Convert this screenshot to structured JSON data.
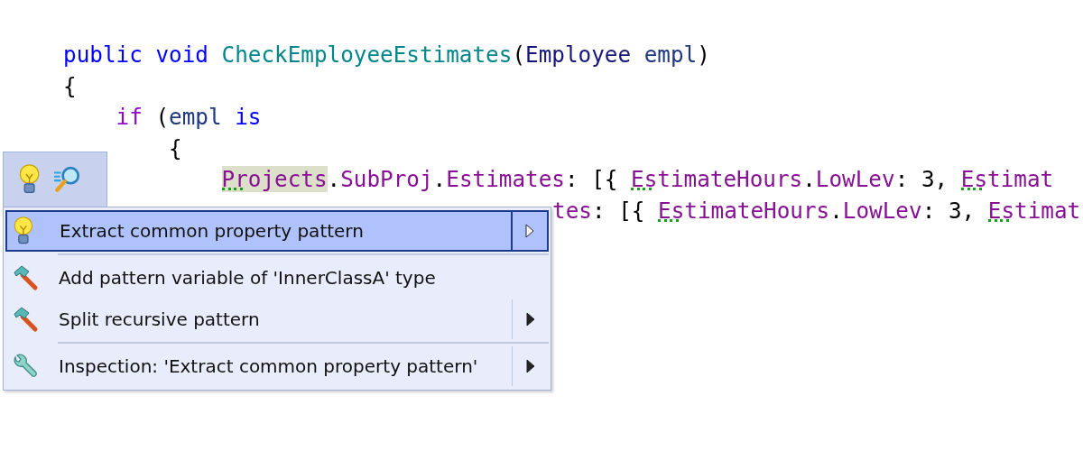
{
  "code_lines": [
    {
      "kind": "signature",
      "tokens": [
        {
          "kind": "keyword",
          "text": "public"
        },
        {
          "kind": "keyword",
          "text": " void"
        },
        {
          "kind": "method",
          "text": " CheckEmployeeEstimates"
        },
        {
          "kind": "punct",
          "text": "("
        },
        {
          "kind": "type",
          "text": "Employee"
        },
        {
          "kind": "param",
          "text": " empl"
        },
        {
          "kind": "punct",
          "text": ")"
        }
      ]
    },
    {
      "kind": "signature",
      "tokens": [
        {
          "kind": "punct",
          "text": "{"
        }
      ]
    },
    {
      "kind": "statement",
      "tokens": [
        {
          "kind": "control",
          "text": "if"
        },
        {
          "kind": "punct",
          "text": " ("
        },
        {
          "kind": "param",
          "text": "empl"
        },
        {
          "kind": "keyword",
          "text": " is"
        }
      ]
    },
    {
      "kind": "pattern",
      "tokens": [
        {
          "kind": "punct",
          "text": "{"
        }
      ]
    },
    {
      "kind": "property",
      "tokens": [
        {
          "kind": "prop",
          "text": "Projects",
          "highlighted": true,
          "hint": true
        },
        {
          "kind": "punct",
          "text": "."
        },
        {
          "kind": "prop",
          "text": "SubProj"
        },
        {
          "kind": "punct",
          "text": "."
        },
        {
          "kind": "prop",
          "text": "Estimates"
        },
        {
          "kind": "punct",
          "text": ": [{ "
        },
        {
          "kind": "prop",
          "text": "EstimateHours",
          "hint": true
        },
        {
          "kind": "punct",
          "text": "."
        },
        {
          "kind": "prop",
          "text": "LowLev"
        },
        {
          "kind": "punct",
          "text": ": 3, "
        },
        {
          "kind": "prop",
          "text": "Estimat",
          "hint": true
        }
      ]
    },
    {
      "kind": "covered",
      "tokens": [
        {
          "kind": "prop",
          "text": "tes"
        },
        {
          "kind": "punct",
          "text": ": [{ "
        },
        {
          "kind": "prop",
          "text": "EstimateHours",
          "hint": true
        },
        {
          "kind": "punct",
          "text": "."
        },
        {
          "kind": "prop",
          "text": "LowLev"
        },
        {
          "kind": "punct",
          "text": ": 3, "
        },
        {
          "kind": "prop",
          "text": "Estimat",
          "hint": true
        }
      ]
    }
  ],
  "toolbar": [
    {
      "kind": "bulb"
    },
    {
      "kind": "find"
    }
  ],
  "menu": [
    {
      "kind": "bulb",
      "label": "Extract common property pattern",
      "selected": true,
      "submenu": true,
      "separator_after": true
    },
    {
      "kind": "hammer",
      "label": "Add pattern variable of 'InnerClassA' type",
      "selected": false,
      "submenu": false,
      "separator_after": false
    },
    {
      "kind": "hammer",
      "label": "Split recursive pattern",
      "selected": false,
      "submenu": true,
      "separator_after": true
    },
    {
      "kind": "wrench",
      "label": "Inspection: 'Extract common property pattern'",
      "selected": false,
      "submenu": true,
      "separator_after": false
    }
  ]
}
